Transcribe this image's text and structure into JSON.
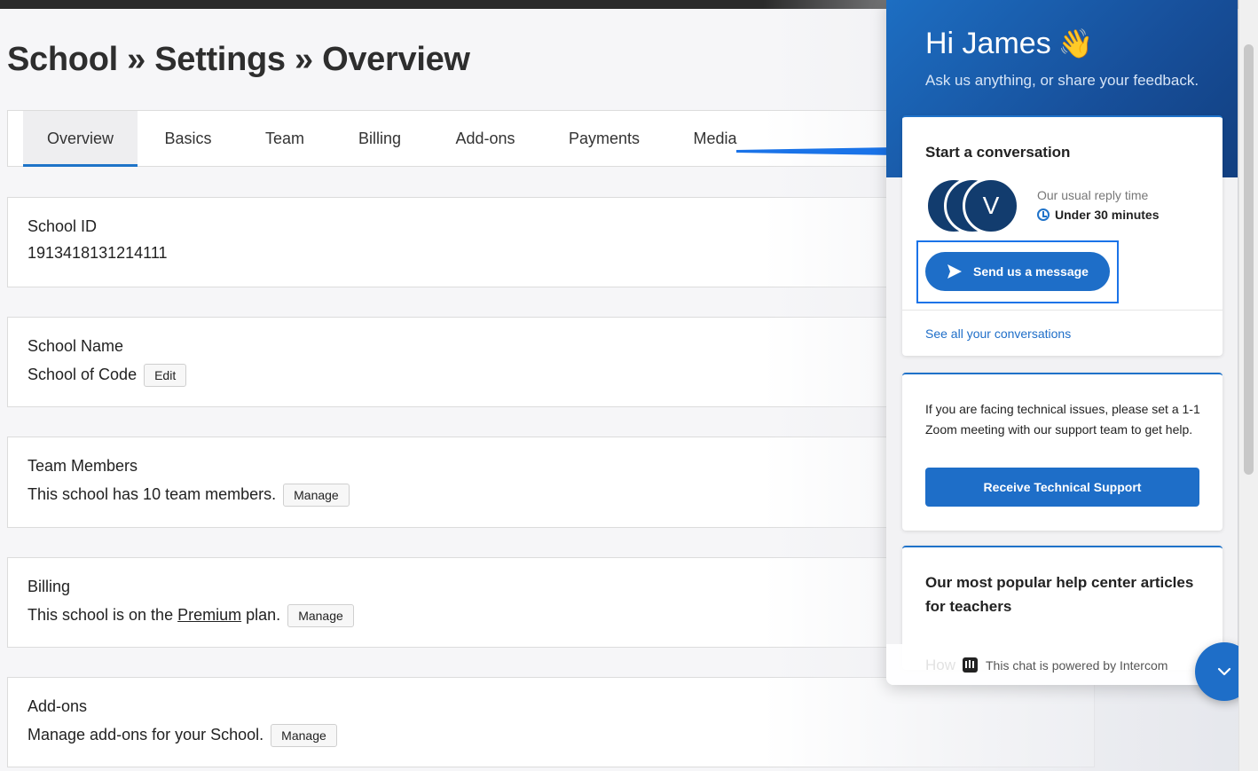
{
  "page": {
    "breadcrumb": "School » Settings » Overview",
    "tabs": [
      "Overview",
      "Basics",
      "Team",
      "Billing",
      "Add-ons",
      "Payments",
      "Media"
    ],
    "active_tab": "Overview"
  },
  "cards": {
    "school_id": {
      "title": "School ID",
      "value": "1913418131214111"
    },
    "school_name": {
      "title": "School Name",
      "value": "School of Code",
      "button": "Edit"
    },
    "team_members": {
      "title": "Team Members",
      "text": "This school has 10 team members.",
      "button": "Manage"
    },
    "billing": {
      "title": "Billing",
      "text_before": "This school is on the",
      "plan": "Premium",
      "text_after": "plan.",
      "button": "Manage"
    },
    "addons": {
      "title": "Add-ons",
      "text": "Manage add-ons for your School.",
      "button": "Manage"
    }
  },
  "chat": {
    "greeting": "Hi James",
    "wave_emoji": "👋",
    "subtitle": "Ask us anything, or share your feedback.",
    "start_title": "Start a conversation",
    "avatar_letter": "V",
    "reply_label": "Our usual reply time",
    "reply_time": "Under 30 minutes",
    "send_button": "Send us a message",
    "see_all": "See all your conversations",
    "tech_text": "If you are facing technical issues, please set a 1-1 Zoom meeting with our support team to get help.",
    "tech_button": "Receive Technical Support",
    "articles_title": "Our most popular help center articles for teachers",
    "ghost_text": "How",
    "powered_by": "This chat is powered by Intercom"
  },
  "colors": {
    "accent": "#1e6ec8",
    "header_dark": "#123f80",
    "highlight": "#1a73e8"
  },
  "icons": [
    "send-icon",
    "clock-icon",
    "intercom-logo-icon",
    "chevron-down-icon",
    "arrow-pointer-icon"
  ]
}
